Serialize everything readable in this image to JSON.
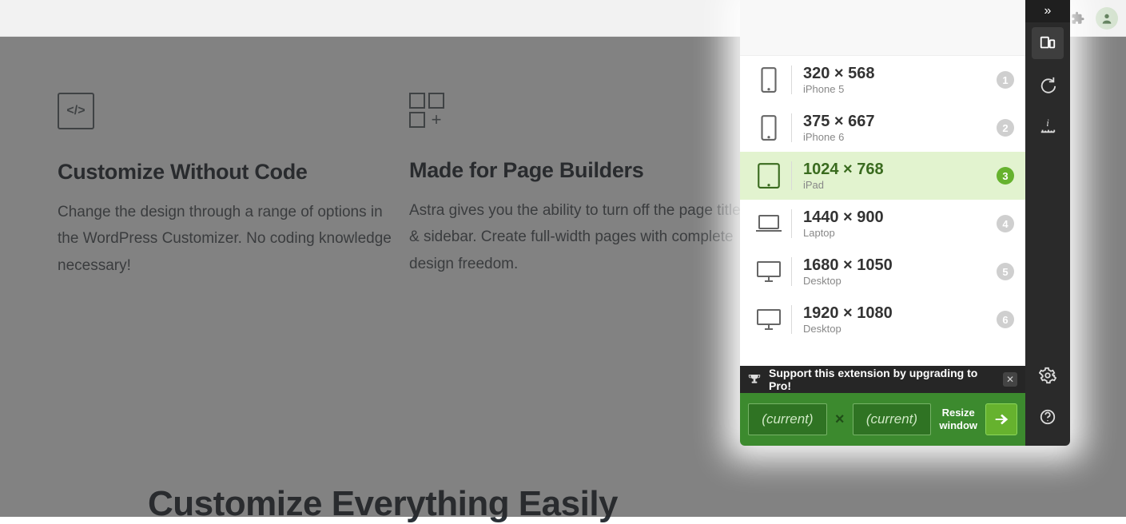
{
  "background": {
    "feature1": {
      "title": "Customize Without Code",
      "body": "Change the design through a range of options in the WordPress Customizer. No coding knowledge necessary!",
      "icon_label": "</>"
    },
    "feature2": {
      "title": "Made for Page Builders",
      "body": "Astra gives you the ability to turn off the page title & sidebar. Create full-width pages with complete design freedom."
    },
    "big_heading": "Customize Everything Easily",
    "right_clip": "t"
  },
  "extension": {
    "presets": [
      {
        "dim": "320 × 568",
        "label": "iPhone 5",
        "num": "1",
        "kind": "phone",
        "selected": false
      },
      {
        "dim": "375 × 667",
        "label": "iPhone 6",
        "num": "2",
        "kind": "phone",
        "selected": false
      },
      {
        "dim": "1024 × 768",
        "label": "iPad",
        "num": "3",
        "kind": "tablet",
        "selected": true
      },
      {
        "dim": "1440 × 900",
        "label": "Laptop",
        "num": "4",
        "kind": "laptop",
        "selected": false
      },
      {
        "dim": "1680 × 1050",
        "label": "Desktop",
        "num": "5",
        "kind": "desktop",
        "selected": false
      },
      {
        "dim": "1920 × 1080",
        "label": "Desktop",
        "num": "6",
        "kind": "desktop",
        "selected": false
      }
    ],
    "promo": "Support this extension by upgrading to Pro!",
    "resize": {
      "width_placeholder": "(current)",
      "height_placeholder": "(current)",
      "label_line1": "Resize",
      "label_line2": "window"
    }
  }
}
